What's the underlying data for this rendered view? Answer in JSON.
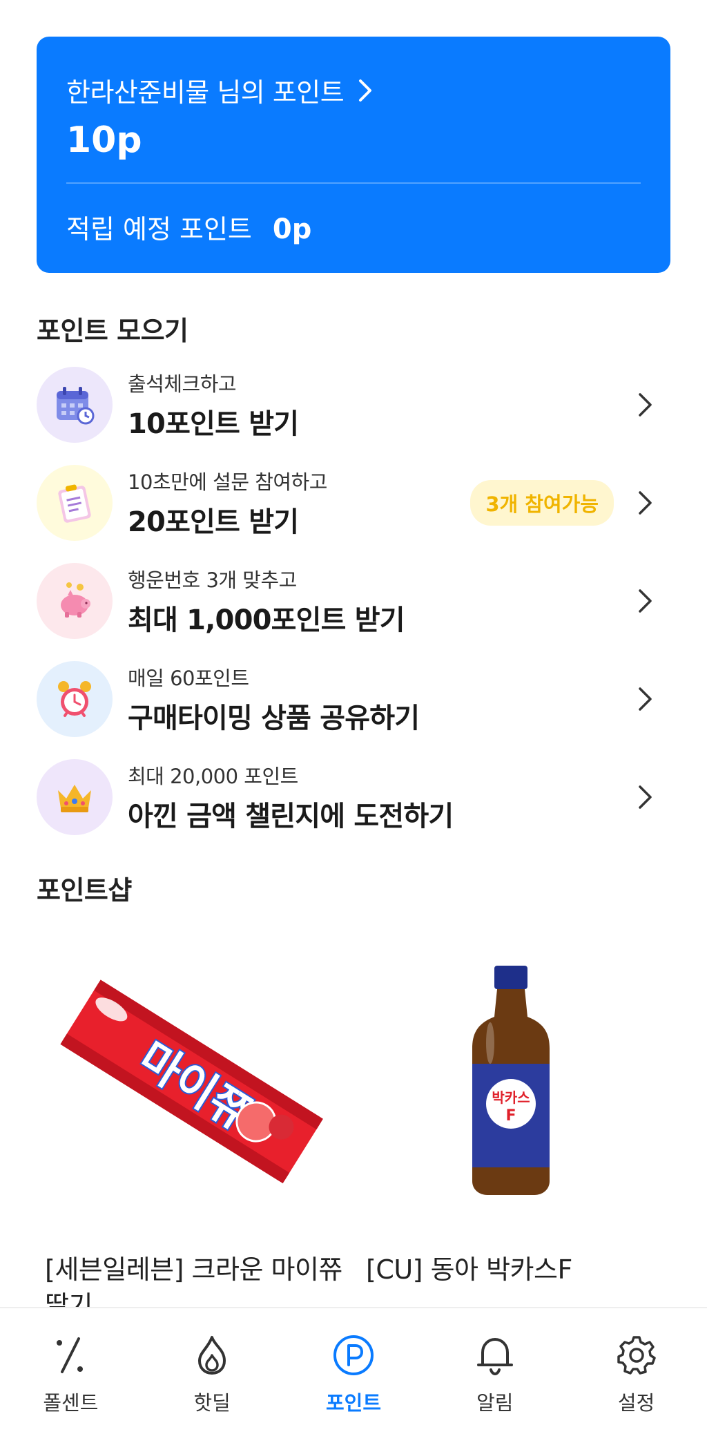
{
  "point_card": {
    "title": "한라산준비물 님의 포인트",
    "amount": "10p",
    "pending_label": "적립 예정 포인트",
    "pending_value": "0p"
  },
  "collect_section": {
    "title": "포인트 모으기",
    "missions": [
      {
        "sub": "출석체크하고",
        "main": "10포인트 받기",
        "icon": "calendar-icon"
      },
      {
        "sub": "10초만에 설문 참여하고",
        "main": "20포인트 받기",
        "badge": "3개 참여가능",
        "icon": "clipboard-icon"
      },
      {
        "sub": "행운번호 3개 맞추고",
        "main": "최대 1,000포인트 받기",
        "icon": "piggy-bank-icon"
      },
      {
        "sub": "매일 60포인트",
        "main": "구매타이밍 상품 공유하기",
        "icon": "alarm-clock-icon"
      },
      {
        "sub": "최대 20,000 포인트",
        "main": "아낀 금액 챌린지에 도전하기",
        "icon": "crown-icon"
      }
    ]
  },
  "shop_section": {
    "title": "포인트샵",
    "products": [
      {
        "name": "[세븐일레븐] 크라운 마이쮸 딸기",
        "image": "candy-pack-image",
        "pack_label": "마이쮸"
      },
      {
        "name": "[CU] 동아 박카스F",
        "image": "bottle-image",
        "bottle_label": "박카스"
      }
    ]
  },
  "tabbar": {
    "tabs": [
      {
        "label": "폴센트",
        "icon": "percent-icon",
        "active": false
      },
      {
        "label": "핫딜",
        "icon": "flame-icon",
        "active": false
      },
      {
        "label": "포인트",
        "icon": "point-p-icon",
        "active": true
      },
      {
        "label": "알림",
        "icon": "bell-icon",
        "active": false
      },
      {
        "label": "설정",
        "icon": "gear-icon",
        "active": false
      }
    ]
  },
  "colors": {
    "accent": "#0a7bff",
    "badge_bg": "#fff6cf",
    "badge_text": "#f0b400"
  }
}
